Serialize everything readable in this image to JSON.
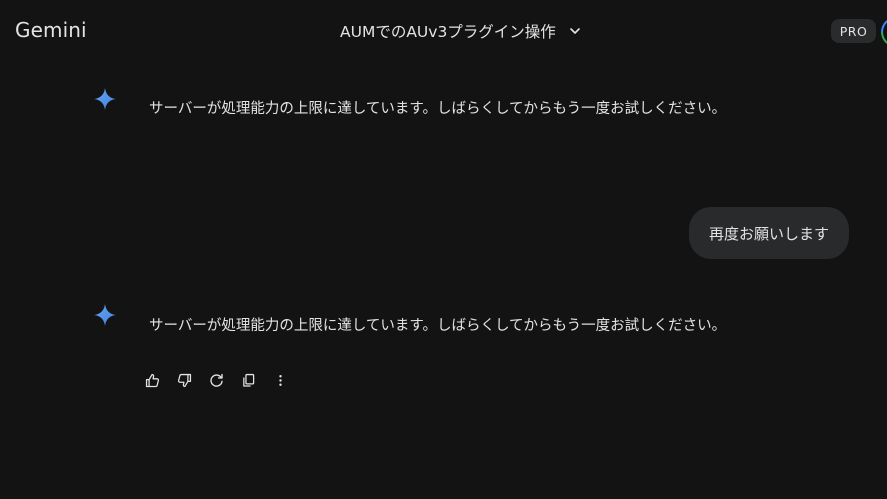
{
  "header": {
    "app_name": "Gemini",
    "conversation_title": "AUMでのAUv3プラグイン操作",
    "plan_badge": "PRO"
  },
  "messages": [
    {
      "role": "model",
      "text": "サーバーが処理能力の上限に達しています。しばらくしてからもう一度お試しください。"
    },
    {
      "role": "user",
      "text": "再度お願いします"
    },
    {
      "role": "model",
      "text": "サーバーが処理能力の上限に達しています。しばらくしてからもう一度お試しください。"
    }
  ],
  "response_actions": [
    {
      "icon": "thumbs-up-icon"
    },
    {
      "icon": "thumbs-down-icon"
    },
    {
      "icon": "regenerate-icon"
    },
    {
      "icon": "copy-icon"
    },
    {
      "icon": "more-vert-icon"
    }
  ],
  "colors": {
    "background": "#131314",
    "text": "#e3e3e3",
    "user_bubble": "#282a2c",
    "badge_bg": "#2a2b2c",
    "sparkle_blue": "#4796e3"
  }
}
